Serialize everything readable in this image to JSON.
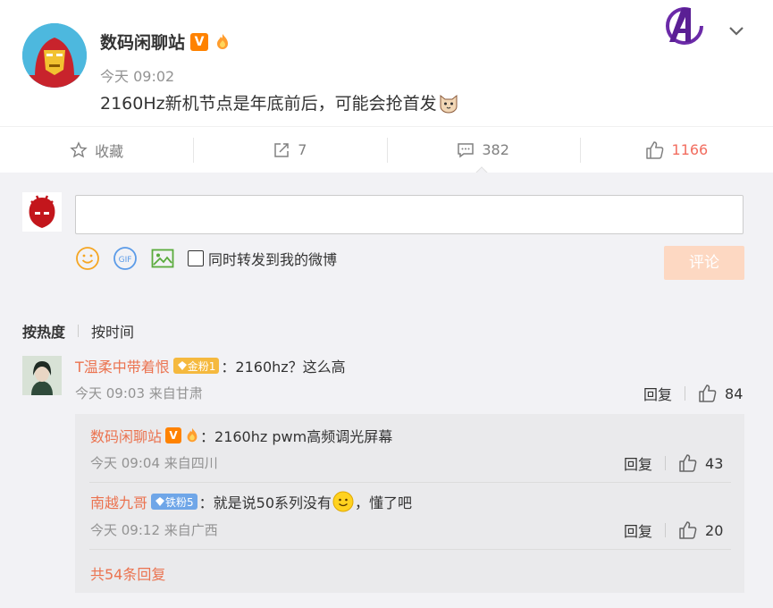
{
  "post": {
    "author": "数码闲聊站",
    "time": "今天 09:02",
    "text": "2160Hz新机节点是年底前后，可能会抢首发",
    "verified_badge": "V"
  },
  "actions": {
    "favorite": "收藏",
    "repost_count": "7",
    "comment_count": "382",
    "like_count": "1166"
  },
  "composer": {
    "input_value": "",
    "gif_label": "GIF",
    "also_repost_label": "同时转发到我的微博",
    "submit_label": "评论"
  },
  "sort": {
    "by_hot": "按热度",
    "by_time": "按时间"
  },
  "comments": [
    {
      "name": "T温柔中带着恨",
      "badge": "金粉1",
      "text": "：2160hz？这么高",
      "meta": "今天 09:03 来自甘肃",
      "reply_label": "回复",
      "likes": "84",
      "replies": [
        {
          "name": "数码闲聊站",
          "verified": "V",
          "text": "：2160hz pwm高频调光屏幕",
          "meta": "今天 09:04 来自四川",
          "reply_label": "回复",
          "likes": "43"
        },
        {
          "name": "南越九哥",
          "badge": "铁粉5",
          "text_before": "：就是说50系列没有",
          "text_after": "，懂了吧",
          "meta": "今天 09:12 来自广西",
          "reply_label": "回复",
          "likes": "20"
        }
      ],
      "more_replies": "共54条回复"
    }
  ],
  "colors": {
    "accent": "#eb7350",
    "like": "#f26d5f",
    "submit_disabled": "#fdd8c2",
    "verified": "#ff8200"
  }
}
